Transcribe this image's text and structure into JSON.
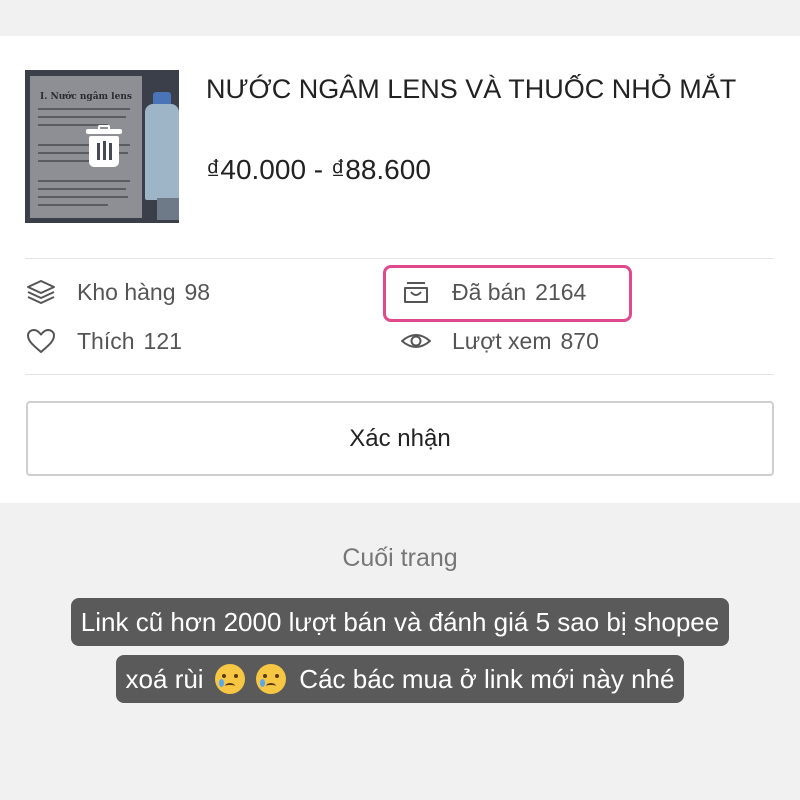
{
  "product": {
    "thumbnail_text": "I. Nước ngâm lens",
    "title": "NƯỚC NGÂM LENS VÀ THUỐC NHỎ MẮT",
    "price_range": "₫40.000 - ₫88.600"
  },
  "stats": {
    "stock_label": "Kho hàng",
    "stock_value": "98",
    "sold_label": "Đã bán",
    "sold_value": "2164",
    "likes_label": "Thích",
    "likes_value": "121",
    "views_label": "Lượt xem",
    "views_value": "870"
  },
  "actions": {
    "confirm_label": "Xác nhận"
  },
  "footer": {
    "end_label": "Cuối trang"
  },
  "caption": {
    "line1": "Link cũ hơn 2000 lượt bán và đánh giá 5 sao bị shopee",
    "line2_prefix": "xoá rùi",
    "line2_suffix": "Các bác mua ở link mới này nhé",
    "emoji": "crying-face"
  },
  "colors": {
    "highlight": "#e0498e",
    "caption_bg": "#5a5a5a"
  },
  "icons": [
    "delete-icon",
    "layers-icon",
    "bag-icon",
    "heart-icon",
    "eye-icon"
  ]
}
